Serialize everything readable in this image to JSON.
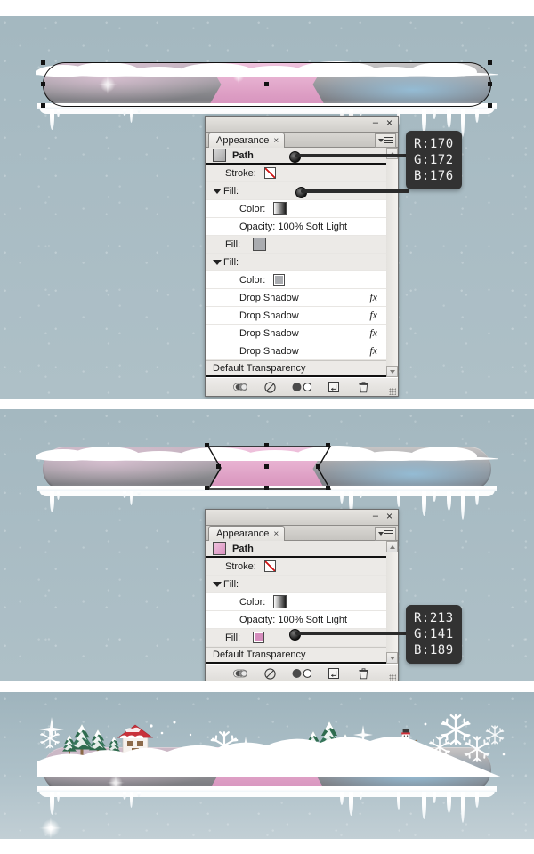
{
  "document": {
    "title": "Adobe Illustrator Appearance panel tutorial — winter banner",
    "background_color": "#a9bcc4"
  },
  "steps": [
    {
      "id": "step-1",
      "banner": {
        "description": "Winter snow banner with gray ends and pink center ribbon, path selected",
        "left_color": "#8e8e92",
        "center_color": "#e9b6d4",
        "right_color": "#8d8d91",
        "selection": "full-bar"
      },
      "panel": {
        "title_tab": "Appearance",
        "tab_close_glyph": "×",
        "minimize_glyph": "–",
        "close_glyph": "×",
        "target_label": "Path",
        "target_swatch_color": "#bfbfbf",
        "rows": [
          {
            "label": "Stroke:",
            "swatch": "none",
            "indent": 1,
            "shade": "gray"
          },
          {
            "label": "Fill:",
            "disclosure": true,
            "indent": 0,
            "shade": "gray"
          },
          {
            "label": "Color:",
            "swatch": "gradient",
            "indent": 2,
            "shade": "white"
          },
          {
            "label": "Opacity: 100% Soft Light",
            "indent": 2,
            "shade": "white"
          },
          {
            "label": "Fill:",
            "swatch": "solid-gray",
            "indent": 1,
            "shade": "gray",
            "handle": true
          },
          {
            "label": "Fill:",
            "disclosure": true,
            "indent": 0,
            "shade": "gray"
          },
          {
            "label": "Color:",
            "swatch": "solid-gray-boxed",
            "indent": 2,
            "shade": "white",
            "handle": true
          },
          {
            "label": "Drop Shadow",
            "fx": "fx",
            "indent": 2,
            "shade": "white"
          },
          {
            "label": "Drop Shadow",
            "fx": "fx",
            "indent": 2,
            "shade": "white"
          },
          {
            "label": "Drop Shadow",
            "fx": "fx",
            "indent": 2,
            "shade": "white"
          },
          {
            "label": "Drop Shadow",
            "fx": "fx",
            "indent": 2,
            "shade": "white"
          }
        ],
        "footer_label": "Default Transparency",
        "toolbar_icons": [
          "add-new-stroke-icon",
          "clear-appearance-icon",
          "duplicate-item-icon",
          "new-art-has-basic-appearance-icon",
          "delete-item-icon"
        ]
      },
      "callout": {
        "r": "R:170",
        "g": "G:172",
        "b": "B:176",
        "hex": "#aaacb0"
      }
    },
    {
      "id": "step-2",
      "banner": {
        "description": "Same banner with only the pink center ribbon path selected",
        "left_color": "#8e8e92",
        "center_color": "#e4a9cd",
        "right_color": "#8d8d91",
        "selection": "center-ribbon"
      },
      "panel": {
        "title_tab": "Appearance",
        "tab_close_glyph": "×",
        "minimize_glyph": "–",
        "close_glyph": "×",
        "target_label": "Path",
        "target_swatch_color": "#e4a9cd",
        "rows": [
          {
            "label": "Stroke:",
            "swatch": "none",
            "indent": 1,
            "shade": "gray"
          },
          {
            "label": "Fill:",
            "disclosure": true,
            "indent": 0,
            "shade": "gray"
          },
          {
            "label": "Color:",
            "swatch": "gradient",
            "indent": 2,
            "shade": "white"
          },
          {
            "label": "Opacity: 100% Soft Light",
            "indent": 2,
            "shade": "white"
          },
          {
            "label": "Fill:",
            "swatch": "pink-boxed",
            "indent": 1,
            "shade": "gray",
            "handle": true
          }
        ],
        "footer_label": "Default Transparency",
        "toolbar_icons": [
          "add-new-stroke-icon",
          "clear-appearance-icon",
          "duplicate-item-icon",
          "new-art-has-basic-appearance-icon",
          "delete-item-icon"
        ]
      },
      "callout": {
        "r": "R:213",
        "g": "G:141",
        "b": "B:189",
        "hex": "#d58dbd"
      }
    },
    {
      "id": "step-3",
      "banner": {
        "description": "Finished banner with snow landscape: pine trees, house, snowman, snowflakes",
        "left_color": "#8e8e92",
        "center_color": "#e9b6d4",
        "right_color": "#8d8d91",
        "selection": "none"
      },
      "scene_elements": [
        "pine-tree",
        "pine-tree",
        "pine-tree",
        "pine-tree",
        "house",
        "snowflake",
        "snowflake",
        "snowflake",
        "pine-tree",
        "pine-tree",
        "pine-tree",
        "snowman",
        "snowflake",
        "snowflake",
        "snowflake",
        "sparkle"
      ]
    }
  ]
}
